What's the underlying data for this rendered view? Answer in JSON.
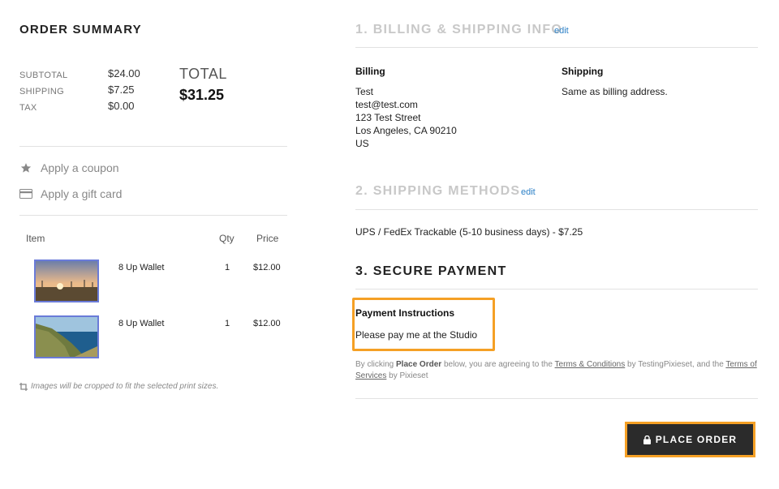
{
  "summary": {
    "title": "ORDER SUMMARY",
    "subtotal_label": "SUBTOTAL",
    "shipping_label": "SHIPPING",
    "tax_label": "TAX",
    "subtotal": "$24.00",
    "shipping": "$7.25",
    "tax": "$0.00",
    "total_label": "TOTAL",
    "total": "$31.25"
  },
  "actions": {
    "coupon_label": "Apply a coupon",
    "coupon_icon": "star-icon",
    "gift_label": "Apply a gift card",
    "gift_icon": "credit-card-icon"
  },
  "items_table": {
    "headers": {
      "item": "Item",
      "qty": "Qty",
      "price": "Price"
    },
    "rows": [
      {
        "name": "8 Up Wallet",
        "qty": "1",
        "price": "$12.00",
        "thumb": "sunset-field-photo"
      },
      {
        "name": "8 Up Wallet",
        "qty": "1",
        "price": "$12.00",
        "thumb": "coastal-cliff-photo"
      }
    ]
  },
  "crop_note": "Images will be cropped to fit the selected print sizes.",
  "billing_section": {
    "title": "1. BILLING & SHIPPING INFO",
    "edit": "edit",
    "billing_head": "Billing",
    "billing_lines": [
      "Test",
      "test@test.com",
      "123 Test Street",
      "Los Angeles, CA 90210",
      "US"
    ],
    "shipping_head": "Shipping",
    "shipping_text": "Same as billing address."
  },
  "shipping_section": {
    "title": "2. SHIPPING METHODS",
    "edit": "edit",
    "method": "UPS / FedEx Trackable (5-10 business days) - $7.25"
  },
  "payment_section": {
    "title": "3. SECURE PAYMENT",
    "instructions_title": "Payment Instructions",
    "instructions_text": "Please pay me at the Studio",
    "terms_pre": "By clicking ",
    "terms_bold": "Place Order",
    "terms_mid": " below, you are agreeing to the ",
    "terms_link1": "Terms & Conditions",
    "terms_mid2": " by TestingPixieset, and the ",
    "terms_link2": "Terms of Services",
    "terms_post": " by Pixieset"
  },
  "place_order": {
    "label": "PLACE ORDER",
    "icon": "lock-icon"
  },
  "colors": {
    "highlight": "#f5a025",
    "link": "#2a7fc6",
    "button_bg": "#2b2b2b"
  }
}
